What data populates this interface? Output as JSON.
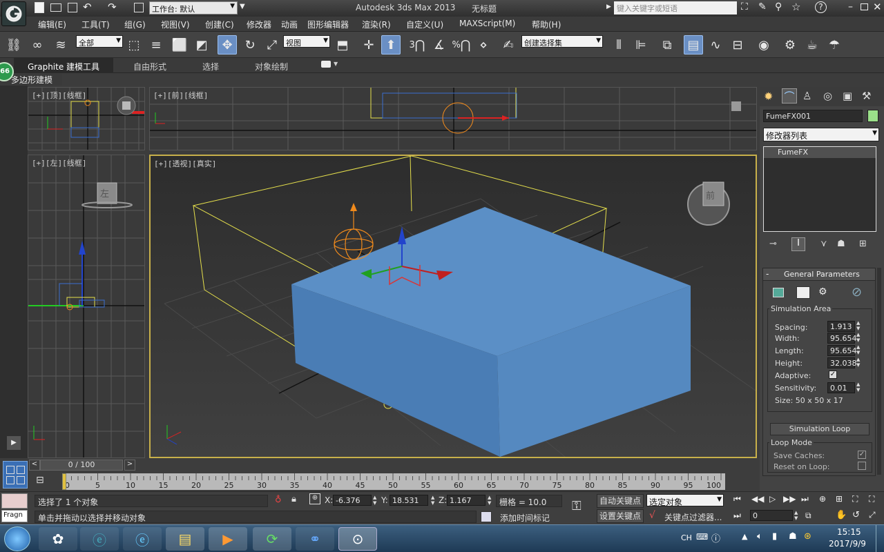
{
  "title": {
    "app": "Autodesk 3ds Max  2013",
    "doc": "无标题",
    "workspace": "工作台: 默认",
    "search_placeholder": "键入关键字或短语"
  },
  "menu": [
    "编辑(E)",
    "工具(T)",
    "组(G)",
    "视图(V)",
    "创建(C)",
    "修改器",
    "动画",
    "图形编辑器",
    "渲染(R)",
    "自定义(U)",
    "MAXScript(M)",
    "帮助(H)"
  ],
  "toolbar": {
    "selection_filter": "全部",
    "ref_coord": "视图",
    "named_selection": "创建选择集",
    "snap_3": "3",
    "snap_percent": "%"
  },
  "ribbon": {
    "tabs": [
      "Graphite 建模工具",
      "自由形式",
      "选择",
      "对象绘制"
    ],
    "sub": "多边形建模",
    "badge": "66"
  },
  "viewports": {
    "top": "[+][顶][线框]",
    "front": "[+][前][线框]",
    "left": "[+][左][线框]",
    "persp": "[+][透视][真实]",
    "viewcube_left": "左",
    "viewcube_persp": "前"
  },
  "cmd": {
    "object_name": "FumeFX001",
    "object_color": "#9be08a",
    "modifier_list": "修改器列表",
    "stack_item": "FumeFX",
    "rollout": "General Parameters",
    "sim_area": "Simulation Area",
    "params": [
      {
        "label": "Spacing:",
        "value": "1.913"
      },
      {
        "label": "Width:",
        "value": "95.654"
      },
      {
        "label": "Length:",
        "value": "95.654"
      },
      {
        "label": "Height:",
        "value": "32.038"
      }
    ],
    "adaptive_label": "Adaptive:",
    "sensitivity_label": "Sensitivity:",
    "sensitivity_value": "0.01",
    "size_text": "Size:  50 x 50 x 17",
    "sim_loop_button": "Simulation Loop",
    "loop_mode": "Loop Mode",
    "save_caches": "Save Caches:",
    "reset_on_loop": "Reset on Loop:"
  },
  "timeline": {
    "frame_display": "0 / 100",
    "ticks": [
      "0",
      "5",
      "10",
      "15",
      "20",
      "25",
      "30",
      "35",
      "40",
      "45",
      "50",
      "55",
      "60",
      "65",
      "70",
      "75",
      "80",
      "85",
      "90",
      "95",
      "100"
    ],
    "current_frame": 0,
    "total_frames": 100
  },
  "status": {
    "selection": "选择了 1 个对象",
    "prompt": "单击并拖动以选择并移动对象",
    "x_label": "X:",
    "x": "-6.376",
    "y_label": "Y:",
    "y": "18.531",
    "z_label": "Z:",
    "z": "1.167",
    "grid": "栅格 = 10.0",
    "add_time_tag": "添加时间标记",
    "auto_key": "自动关键点",
    "set_key": "设置关键点",
    "selected_object": "选定对象",
    "key_filter": "关键点过滤器...",
    "frame_field": "0",
    "script_label": "Fragn"
  },
  "tray": {
    "lang": "CH",
    "time": "15:15",
    "date": "2017/9/9"
  },
  "colors": {
    "box": "#5b8fc6",
    "selection": "#e6e04c",
    "helper": "#f08a1c",
    "grid": "#5a5a5a",
    "active_border": "#c8b04a"
  }
}
